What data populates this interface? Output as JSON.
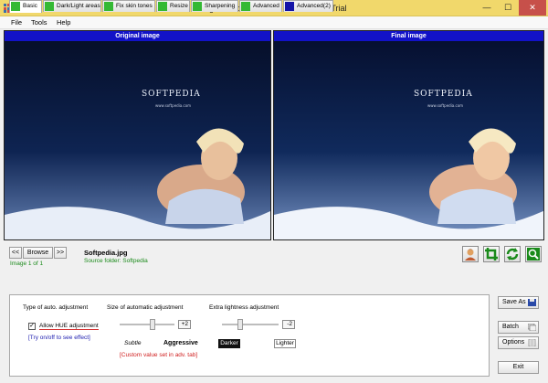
{
  "window": {
    "title": "Digital Photo Finalizer - Pro Edition Trial",
    "min_glyph": "—",
    "max_glyph": "☐",
    "close_glyph": "✕"
  },
  "menu": [
    "File",
    "Tools",
    "Help"
  ],
  "panes": {
    "original_label": "Original image",
    "final_label": "Final image",
    "watermark": "SOFTPEDIA",
    "url_text": "www.softpedia.com"
  },
  "navigation": {
    "prev_label": "<<",
    "browse_label": "Browse",
    "next_label": ">>",
    "filename": "Softpedia.jpg",
    "source_folder": "Source folder: Softpedia",
    "image_count": "Image 1 of 1"
  },
  "tabs": [
    {
      "label": "Basic",
      "check": "green"
    },
    {
      "label": "Dark/Light areas",
      "check": "green"
    },
    {
      "label": "Fix skin tones",
      "check": "green"
    },
    {
      "label": "Resize",
      "check": "green"
    },
    {
      "label": "Sharpening",
      "check": "green"
    },
    {
      "label": "Advanced",
      "check": "green"
    },
    {
      "label": "Advanced(2)",
      "check": "blue"
    }
  ],
  "basic_panel": {
    "auto_type_heading": "Type of auto. adjustment",
    "hue_checked_glyph": "✓",
    "hue_label": "Allow HUE adjustment",
    "hue_hint": "[Try on/off to see effect]",
    "size_heading": "Size of automatic adjustment",
    "size_value": "+2",
    "size_level": 0.62,
    "subtle_label": "Subtle",
    "aggressive_label": "Aggressive",
    "custom_note": "[Custom value set in adv. tab]",
    "lightness_heading": "Extra lightness adjustment",
    "lightness_value": "-2",
    "lightness_level": 0.3,
    "darker_label": "Darker",
    "lighter_label": "Lighter"
  },
  "side_buttons": {
    "save_as": "Save As",
    "batch": "Batch",
    "options": "Options",
    "exit": "Exit"
  },
  "colors": {
    "title_bar": "#f1d86b",
    "pane_header": "#1212c8",
    "tab_check": "#34b934",
    "hint_text": "#2020b0",
    "note_text": "#d02020",
    "status_text": "#1a8a1a"
  }
}
